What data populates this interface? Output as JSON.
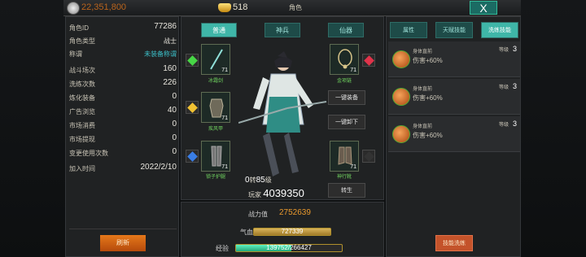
{
  "topbar": {
    "silver": "22,351,800",
    "gold": "518",
    "title": "角色",
    "close_label": "X"
  },
  "info": {
    "rows": [
      {
        "label": "角色ID",
        "value": "77286"
      },
      {
        "label": "角色类型",
        "value": "战士"
      },
      {
        "label": "称谓",
        "value": "未装备称谓"
      },
      {
        "label": "战斗场次",
        "value": "160"
      },
      {
        "label": "洗练次数",
        "value": "226"
      },
      {
        "label": "炼化装备",
        "value": "0"
      },
      {
        "label": "广告浏览",
        "value": "40"
      },
      {
        "label": "市场消费",
        "value": "0"
      },
      {
        "label": "市场提现",
        "value": "0"
      },
      {
        "label": "变更使用次数",
        "value": "0"
      },
      {
        "label": "加入时间",
        "value": "2022/2/10"
      }
    ],
    "button": "刷新"
  },
  "tabs": [
    "普通",
    "神兵",
    "仙器"
  ],
  "slots": [
    {
      "name": "冰霜剑",
      "level": "71"
    },
    {
      "name": "疾风甲",
      "level": "71"
    },
    {
      "name": "锁子护腿",
      "level": "71"
    },
    {
      "name": "金项链",
      "level": "71"
    },
    {
      "name": "神行靴",
      "level": "71"
    }
  ],
  "actions": {
    "equip_all": "一键装备",
    "unequip_all": "一键卸下",
    "reborn": "转生"
  },
  "character": {
    "reborn_prefix": "0",
    "reborn_unit": "转",
    "level": "85",
    "level_unit": "级",
    "player_label": "玩家",
    "player_id": "4039350"
  },
  "stats": {
    "power_label": "战力值",
    "power": "2752639",
    "hp_label": "气血",
    "hp": "727339",
    "hp_ratio": 1.0,
    "xp_label": "经验",
    "xp_current": "139752",
    "xp_sep": "/",
    "xp_max": "266427",
    "xp_ratio": 0.525
  },
  "right_tabs": [
    "属性",
    "天赋技能",
    "洗练技能"
  ],
  "skills": [
    {
      "name": "身体直前",
      "effect": "伤害+60%",
      "level_label": "等级",
      "level": "3"
    },
    {
      "name": "身体直前",
      "effect": "伤害+60%",
      "level_label": "等级",
      "level": "3"
    },
    {
      "name": "身体直前",
      "effect": "伤害+60%",
      "level_label": "等级",
      "level": "3"
    }
  ],
  "right_button": "技能洗练",
  "colors": {
    "accent": "#3fb6a8",
    "orange": "#e5781a",
    "power": "#e9992d",
    "xp": "#3fd6a4",
    "hp": "#c9a24a"
  }
}
